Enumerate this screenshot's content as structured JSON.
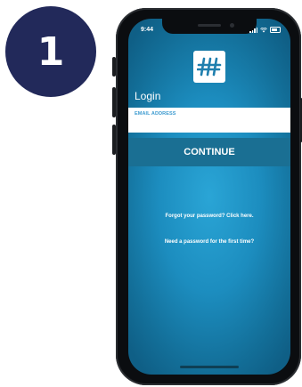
{
  "step_badge": {
    "number": "1"
  },
  "status_bar": {
    "time": "9:44"
  },
  "app": {
    "logo": "hash-logo",
    "title": "Login",
    "email": {
      "label": "EMAIL ADDRESS",
      "value": ""
    },
    "continue_label": "CONTINUE",
    "forgot_link": "Forgot your password? Click here.",
    "first_time_link": "Need a password for the first time?"
  },
  "colors": {
    "badge": "#22295a",
    "screen_bg": "#1c8dbf",
    "continue_bg": "#1a6f93",
    "label_blue": "#3d9bd0"
  }
}
